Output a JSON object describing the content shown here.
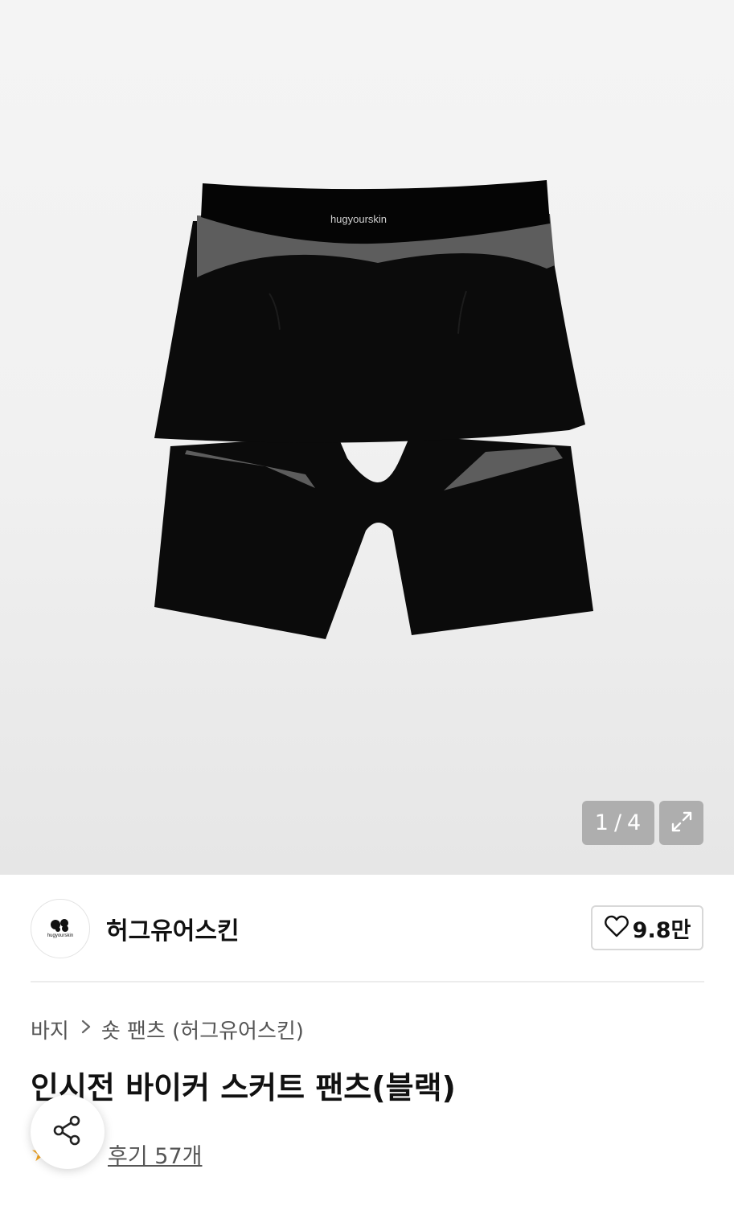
{
  "gallery": {
    "current": "1",
    "separator": "/",
    "total": "4",
    "garment_brand_text": "hugyourskin"
  },
  "brand": {
    "name": "허그유어스킨",
    "logo_text": "hugyourskin"
  },
  "like": {
    "count": "9.8만"
  },
  "breadcrumb": {
    "category": "바지",
    "subcategory": "숏 팬츠 (허그유어스킨)"
  },
  "product": {
    "title": "인시전 바이커 스커트 팬츠(블랙)"
  },
  "reviews": {
    "link_label": "후기 57개"
  },
  "icons": {
    "expand": "expand-icon",
    "heart": "heart-icon",
    "chevron": "chevron-right-icon",
    "share": "share-icon",
    "star": "star-icon"
  },
  "colors": {
    "star": "#f5a623",
    "garment_black": "#0b0b0b",
    "garment_gray": "#5d5d5d"
  }
}
